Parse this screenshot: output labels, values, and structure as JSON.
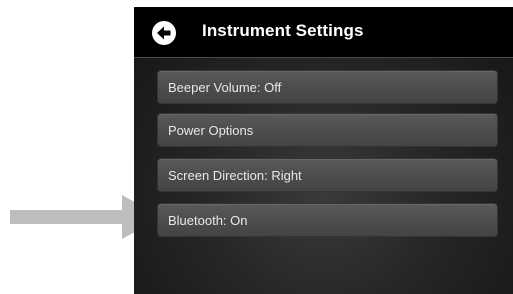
{
  "header": {
    "title": "Instrument Settings",
    "back_icon": "back-arrow-icon"
  },
  "menu": {
    "items": [
      {
        "label": "Beeper Volume: Off"
      },
      {
        "label": "Power Options"
      },
      {
        "label": "Screen Direction: Right"
      },
      {
        "label": "Bluetooth: On"
      }
    ]
  },
  "annotation": {
    "pointer_icon": "pointer-arrow-icon",
    "points_to": "Bluetooth: On"
  },
  "colors": {
    "header_background": "#000000",
    "screen_background": "#262626",
    "item_background": "#4d4d4d",
    "text": "#ffffff",
    "pointer_arrow": "#bdbdbd"
  }
}
